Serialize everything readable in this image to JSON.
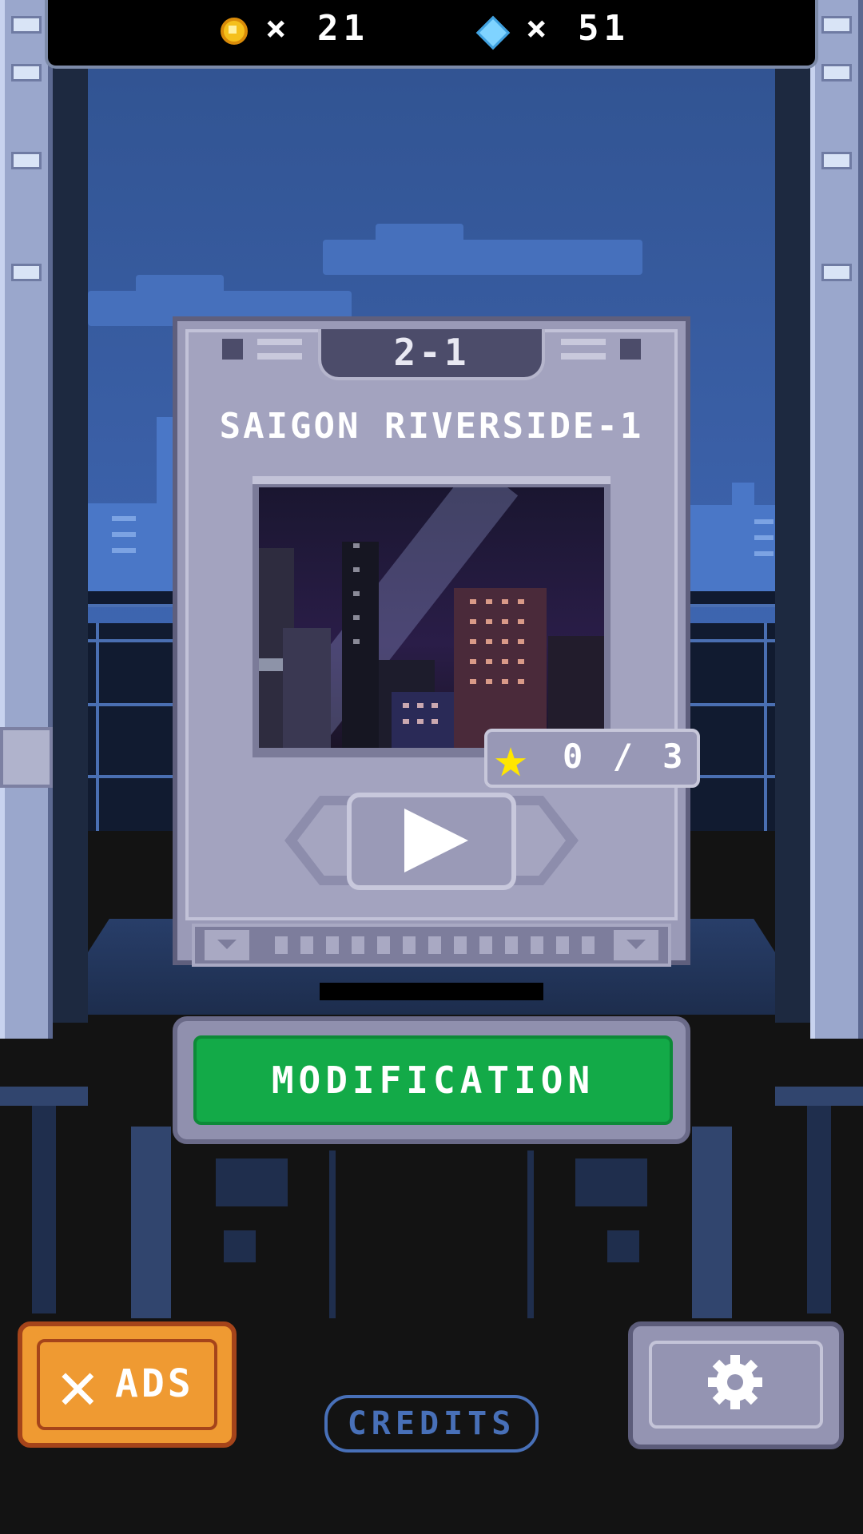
{
  "hud": {
    "coins_label": "× 21",
    "gems_label": "× 51",
    "coin_icon": "coin-icon",
    "gem_icon": "gem-icon"
  },
  "level_card": {
    "level_number": "2-1",
    "level_name": "SAIGON RIVERSIDE-1",
    "stars": "0 / 3",
    "star_icon": "star-icon",
    "play_icon": "play-icon",
    "pager_pages": 13
  },
  "buttons": {
    "modification": "MODIFICATION",
    "remove_ads": "ADS",
    "remove_ads_icon": "x-icon",
    "credits": "CREDITS",
    "settings_icon": "gear-icon"
  },
  "colors": {
    "modification_green": "#13aa48",
    "ads_orange": "#ef9a32",
    "star_yellow": "#ffe600",
    "coin_gold": "#f5c01b",
    "gem_blue": "#7fd3ff",
    "credits_blue": "#4870b8"
  }
}
